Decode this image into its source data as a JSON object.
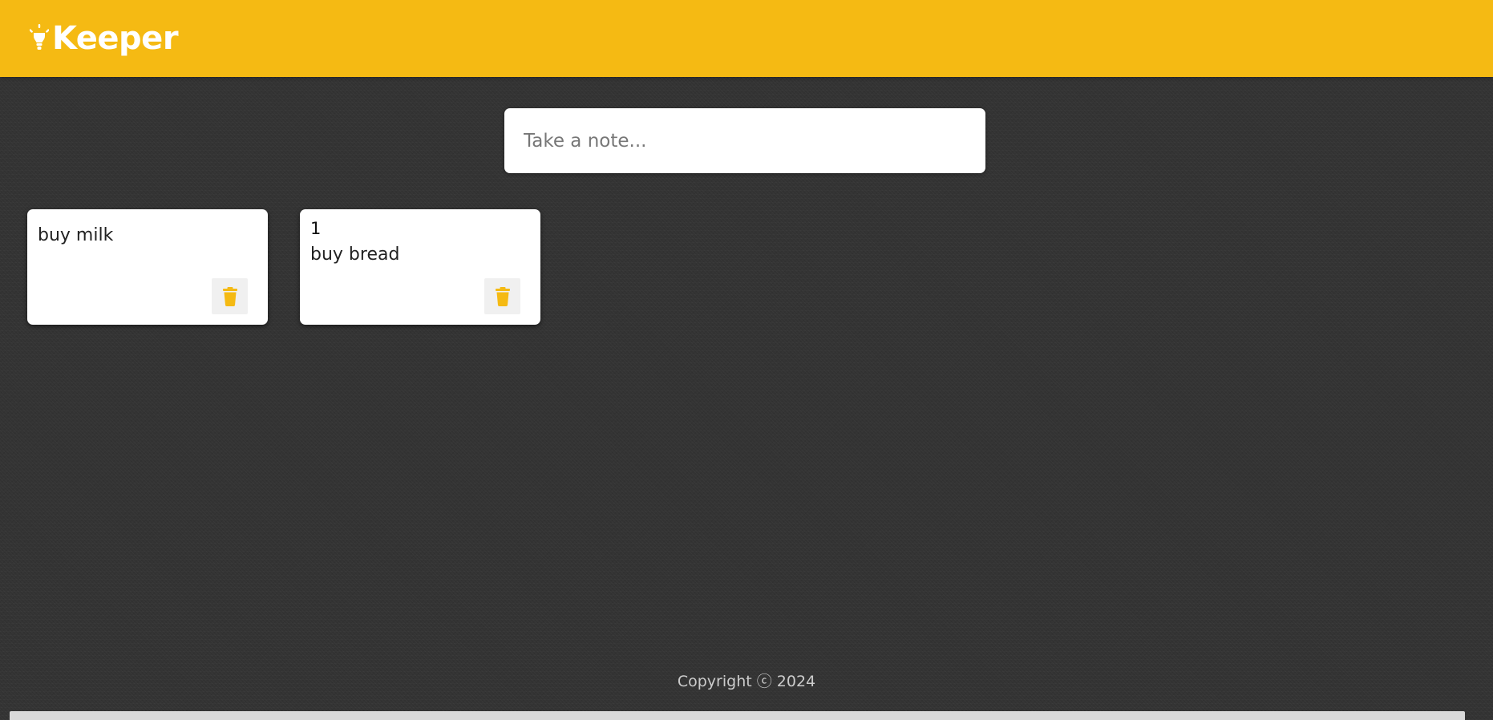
{
  "header": {
    "app_name": "Keeper",
    "logo_icon": "lightbulb-icon",
    "brand_color": "#f5ba13"
  },
  "create_area": {
    "placeholder": "Take a note..."
  },
  "notes": [
    {
      "title": "",
      "content": "buy milk",
      "delete_icon": "trash-icon"
    },
    {
      "title": "1",
      "content": "buy bread",
      "delete_icon": "trash-icon"
    }
  ],
  "footer": {
    "copyright": "Copyright ⓒ 2024"
  }
}
